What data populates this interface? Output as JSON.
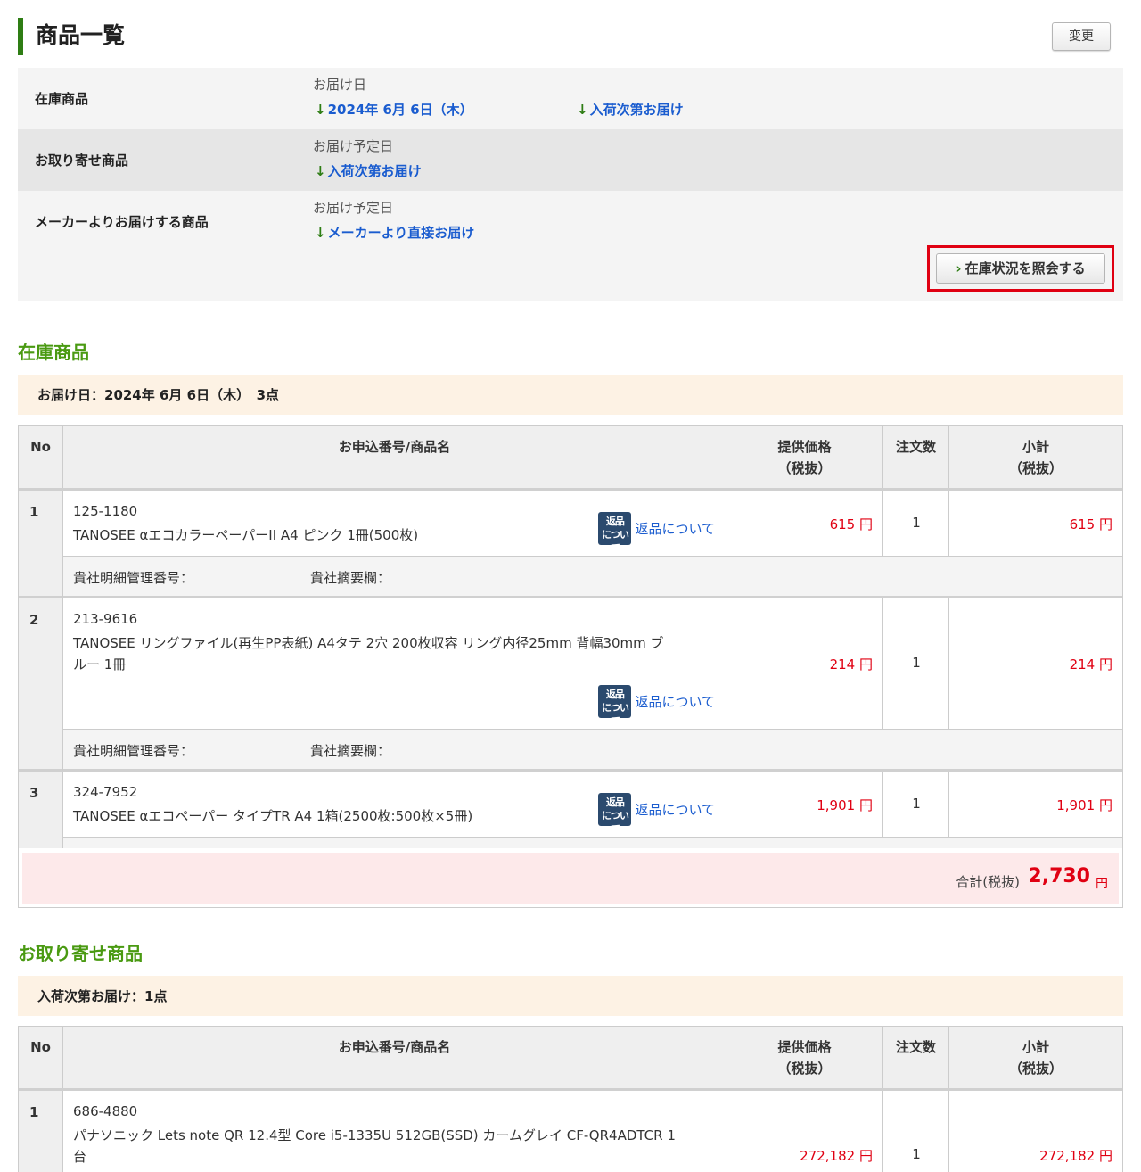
{
  "header": {
    "title": "商品一覧",
    "change_label": "変更"
  },
  "delivery": {
    "rows": [
      {
        "label": "在庫商品",
        "sub": "お届け日",
        "links": [
          "2024年 6月 6日（木）",
          "入荷次第お届け"
        ]
      },
      {
        "label": "お取り寄せ商品",
        "sub": "お届け予定日",
        "links": [
          "入荷次第お届け"
        ]
      },
      {
        "label": "メーカーよりお届けする商品",
        "sub": "お届け予定日",
        "links": [
          "メーカーより直接お届け"
        ]
      }
    ],
    "arrow": "↓",
    "stock_button": "在庫状況を照会する"
  },
  "table_headers": {
    "no": "No",
    "name": "お申込番号/商品名",
    "price_l1": "提供価格",
    "price_l2": "（税抜）",
    "qty": "注文数",
    "sub_l1": "小計",
    "sub_l2": "（税抜）"
  },
  "common": {
    "return_badge_l1": "返品",
    "return_badge_l2": "について",
    "return_link": "返品について",
    "memo_a": "貴社明細管理番号：",
    "memo_b": "貴社摘要欄：",
    "yen": "円"
  },
  "stock_section": {
    "title": "在庫商品",
    "summary": "お届け日：2024年 6月 6日（木）　3点",
    "items": [
      {
        "no": "1",
        "code": "125-1180",
        "name": "TANOSEE αエコカラーペーパーII A4 ピンク 1冊(500枚)",
        "price": "615",
        "qty": "1",
        "subtotal": "615"
      },
      {
        "no": "2",
        "code": "213-9616",
        "name_l1": "TANOSEE リングファイル(再生PP表紙) A4タテ 2穴 200枚収容 リング内径25mm 背幅30mm ブ",
        "name_l2": "ルー 1冊",
        "price": "214",
        "qty": "1",
        "subtotal": "214"
      },
      {
        "no": "3",
        "code": "324-7952",
        "name": "TANOSEE αエコペーパー タイプTR A4 1箱(2500枚:500枚×5冊)",
        "price": "1,901",
        "qty": "1",
        "subtotal": "1,901"
      }
    ],
    "total_label": "合計(税抜)",
    "total_value": "2,730"
  },
  "order_section": {
    "title": "お取り寄せ商品",
    "summary": "入荷次第お届け：1点",
    "items": [
      {
        "no": "1",
        "code": "686-4880",
        "name_l1": "パナソニック Lets note QR 12.4型 Core i5-1335U 512GB(SSD) カームグレイ CF-QR4ADTCR 1",
        "name_l2": "台",
        "price": "272,182",
        "qty": "1",
        "subtotal": "272,182"
      }
    ]
  }
}
